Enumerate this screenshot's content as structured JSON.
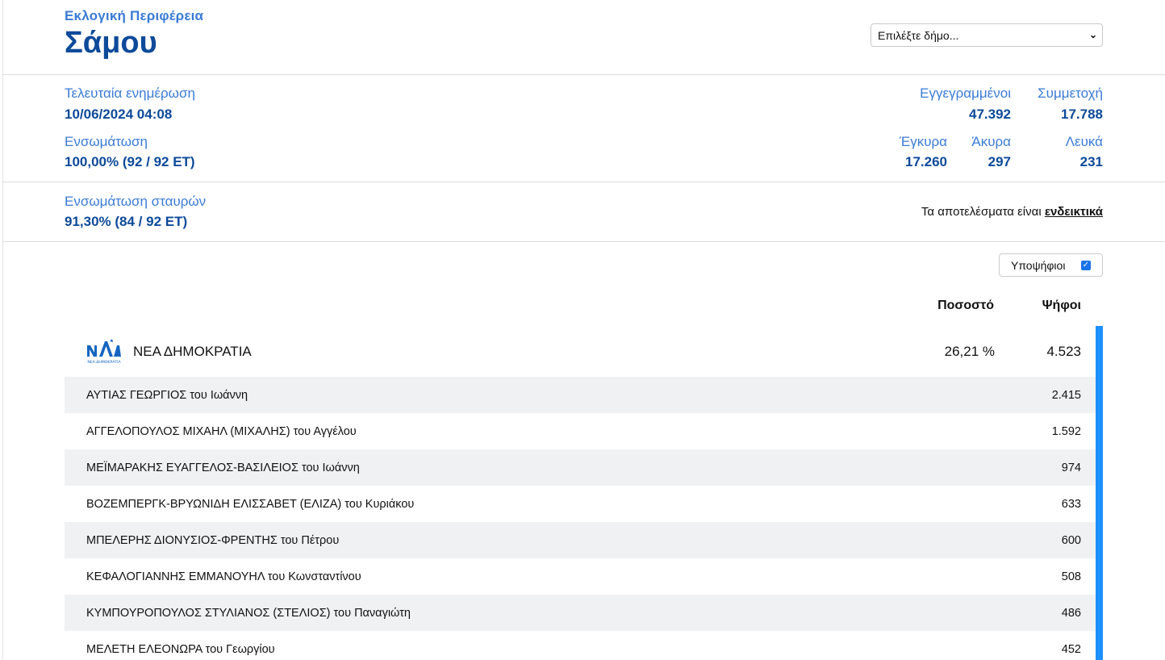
{
  "header": {
    "region_label": "Εκλογική Περιφέρεια",
    "region_name": "Σάμου"
  },
  "municipality_select": {
    "value": "Επιλέξτε δήμο..."
  },
  "stats": {
    "last_update_label": "Τελευταία ενημέρωση",
    "last_update_value": "10/06/2024 04:08",
    "incorporation_label": "Ενσωμάτωση",
    "incorporation_value": "100,00% (92 / 92 ΕΤ)",
    "registered_label": "Εγγεγραμμένοι",
    "registered_value": "47.392",
    "participation_label": "Συμμετοχή",
    "participation_value": "17.788",
    "valid_label": "Έγκυρα",
    "valid_value": "17.260",
    "invalid_label": "Άκυρα",
    "invalid_value": "297",
    "blank_label": "Λευκά",
    "blank_value": "231",
    "cross_label": "Ενσωμάτωση σταυρών",
    "cross_value": "91,30% (84 / 92 ΕΤ)"
  },
  "note": {
    "prefix": "Τα αποτελέσματα είναι ",
    "emphasis": "ενδεικτικά"
  },
  "candidates_toggle": {
    "label": "Υποψήφιοι",
    "checked": true
  },
  "columns": {
    "percent": "Ποσοστό",
    "votes": "Ψήφοι"
  },
  "party": {
    "logo_text": "ΝΕΑ ΔΗΜΟΚΡΑΤΙΑ",
    "name": "ΝΕΑ ΔΗΜΟΚΡΑΤΙΑ",
    "percent": "26,21 %",
    "votes": "4.523",
    "color": "#1e90ff"
  },
  "candidates": [
    {
      "name": "ΑΥΤΙΑΣ ΓΕΩΡΓΙΟΣ του Ιωάννη",
      "votes": "2.415"
    },
    {
      "name": "ΑΓΓΕΛΟΠΟΥΛΟΣ ΜΙΧΑΗΛ (ΜΙΧΑΛΗΣ) του Αγγέλου",
      "votes": "1.592"
    },
    {
      "name": "ΜΕΪΜΑΡΑΚΗΣ ΕΥΑΓΓΕΛΟΣ-ΒΑΣΙΛΕΙΟΣ του Ιωάννη",
      "votes": "974"
    },
    {
      "name": "ΒΟΖΕΜΠΕΡΓΚ-ΒΡΥΩΝΙΔΗ ΕΛΙΣΣΑΒΕΤ (ΕΛΙΖΑ) του Κυριάκου",
      "votes": "633"
    },
    {
      "name": "ΜΠΕΛΕΡΗΣ ΔΙΟΝΥΣΙΟΣ-ΦΡΕΝΤΗΣ του Πέτρου",
      "votes": "600"
    },
    {
      "name": "ΚΕΦΑΛΟΓΙΑΝΝΗΣ ΕΜΜΑΝΟΥΗΛ του Κωνσταντίνου",
      "votes": "508"
    },
    {
      "name": "ΚΥΜΠΟΥΡΟΠΟΥΛΟΣ ΣΤΥΛΙΑΝΟΣ (ΣΤΕΛΙΟΣ) του Παναγιώτη",
      "votes": "486"
    },
    {
      "name": "ΜΕΛΕΤΗ ΕΛΕΟΝΩΡΑ του Γεωργίου",
      "votes": "452"
    }
  ]
}
